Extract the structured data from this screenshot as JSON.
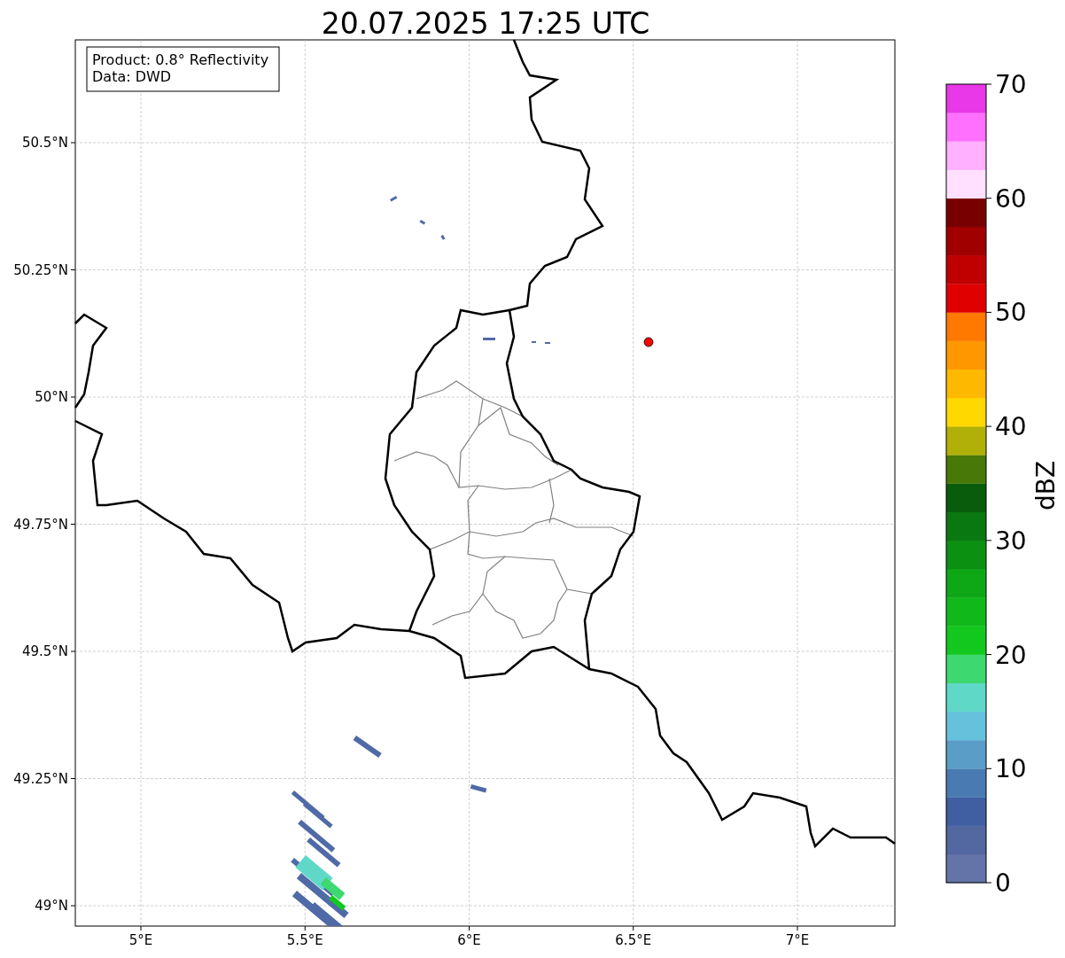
{
  "title": "20.07.2025 17:25 UTC",
  "info_box": [
    "Product: 0.8° Reflectivity",
    "Data: DWD"
  ],
  "map": {
    "lat_ticks": [
      "50.5°N",
      "50.25°N",
      "50°N",
      "49.75°N",
      "49.5°N",
      "49.25°N",
      "49°N"
    ],
    "lon_ticks": [
      "5°E",
      "5.5°E",
      "6°E",
      "6.5°E",
      "7°E"
    ]
  },
  "colorbar": {
    "label": "dBZ",
    "ticks": [
      "70",
      "60",
      "50",
      "40",
      "30",
      "20",
      "10",
      "0"
    ],
    "bins": [
      {
        "color": "#6474a8"
      },
      {
        "color": "#5367a0"
      },
      {
        "color": "#405ea2"
      },
      {
        "color": "#4a7ab2"
      },
      {
        "color": "#5a9ec8"
      },
      {
        "color": "#66c2dc"
      },
      {
        "color": "#60d8c8"
      },
      {
        "color": "#3dd870"
      },
      {
        "color": "#12c81e"
      },
      {
        "color": "#10b81a"
      },
      {
        "color": "#0ea816"
      },
      {
        "color": "#0c9012"
      },
      {
        "color": "#0a7810"
      },
      {
        "color": "#085c0c"
      },
      {
        "color": "#487808"
      },
      {
        "color": "#b0b008"
      },
      {
        "color": "#ffd800"
      },
      {
        "color": "#ffb800"
      },
      {
        "color": "#ff9800"
      },
      {
        "color": "#ff7800"
      },
      {
        "color": "#e00000"
      },
      {
        "color": "#c00000"
      },
      {
        "color": "#a00000"
      },
      {
        "color": "#780000"
      },
      {
        "color": "#ffe0ff"
      },
      {
        "color": "#ffb0ff"
      },
      {
        "color": "#ff70ff"
      },
      {
        "color": "#e838e8"
      }
    ]
  }
}
